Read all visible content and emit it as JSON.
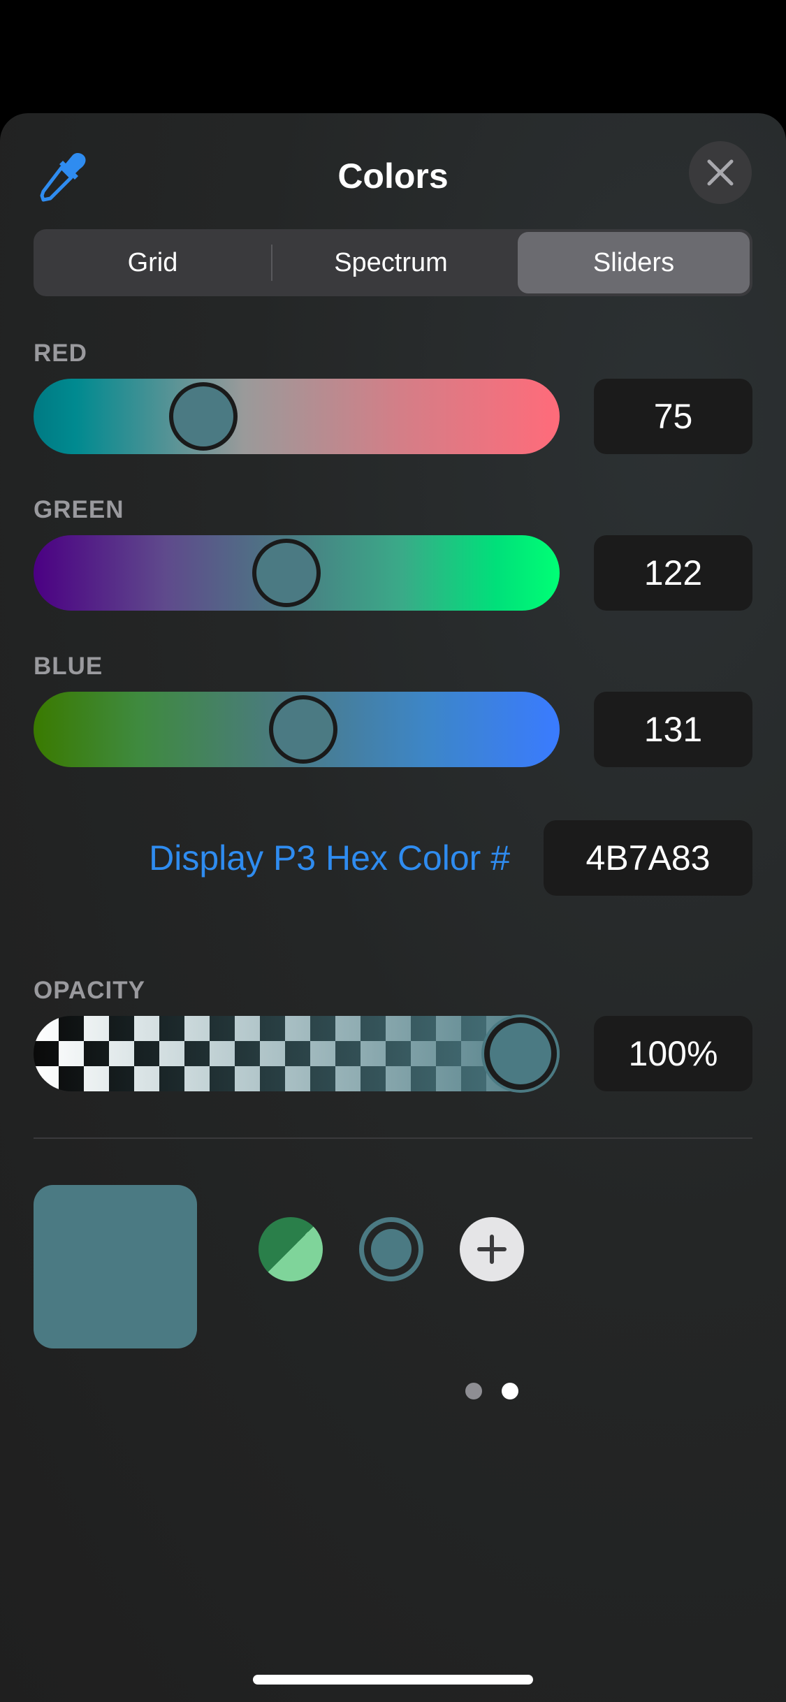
{
  "header": {
    "title": "Colors",
    "eyedropper_icon": "eyedropper-icon",
    "close_icon": "close-icon"
  },
  "segments": {
    "items": [
      "Grid",
      "Spectrum",
      "Sliders"
    ],
    "selected": "Sliders"
  },
  "sliders": {
    "red": {
      "label": "RED",
      "value": "75",
      "fraction": 0.294
    },
    "green": {
      "label": "GREEN",
      "value": "122",
      "fraction": 0.478
    },
    "blue": {
      "label": "BLUE",
      "value": "131",
      "fraction": 0.514
    }
  },
  "hex": {
    "label": "Display P3 Hex Color #",
    "value": "4B7A83"
  },
  "opacity": {
    "label": "OPACITY",
    "value": "100%",
    "fraction": 1.0
  },
  "colors": {
    "current": "#4B7A83",
    "accent": "#2F8CF0",
    "swatch_dark_green": "#2A7F4A",
    "swatch_light_green": "#7FD49A"
  },
  "swatches": {
    "add_icon": "plus-icon"
  },
  "pager": {
    "pages": 2,
    "current": 2
  }
}
